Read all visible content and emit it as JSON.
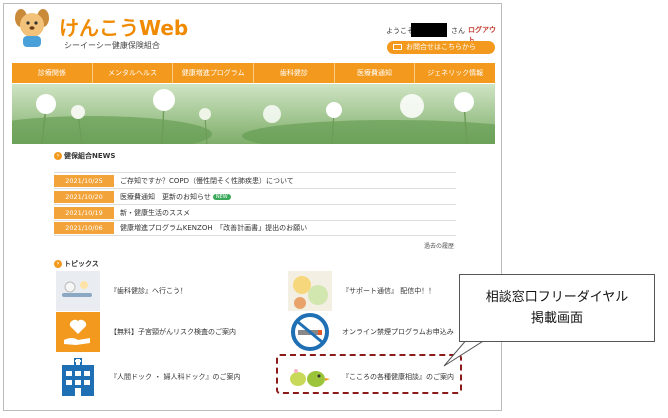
{
  "header": {
    "brand": "けんこうWeb",
    "sub_brand": "シーイーシー健康保険組合",
    "welcome": "ようこそ",
    "honorific": "さん",
    "logout": "ログアウト",
    "inquiry": "お問合せはこちらから"
  },
  "nav": [
    "診療関係",
    "メンタルヘルス",
    "健康増進プログラム",
    "歯科健診",
    "医療費通知",
    "ジェネリック情報"
  ],
  "news": {
    "heading": "健保組合NEWS",
    "items": [
      {
        "date": "2021/10/25",
        "title": "ご存知ですか？COPD（慢性閉そく性肺疾患）について"
      },
      {
        "date": "2021/10/20",
        "title": "医療費通知　更新のお知らせ",
        "badge": "NEW"
      },
      {
        "date": "2021/10/19",
        "title": "新・健康生活のススメ"
      },
      {
        "date": "2021/10/06",
        "title": "健康増進プログラムKENZOH　「改善計画書」提出のお願い"
      }
    ],
    "past_link": "過去の履歴"
  },
  "topics": {
    "heading": "トピックス",
    "items": [
      {
        "label": "『歯科健診』へ行こう！",
        "icon": "dental-icon"
      },
      {
        "label": "『サポート通信』 配信中！！",
        "icon": "food-photo-icon"
      },
      {
        "label": "【無料】子宮頸がんリスク検査のご案内",
        "icon": "heart-hand-icon"
      },
      {
        "label": "オンライン禁煙プログラムお申込み",
        "icon": "no-smoking-icon"
      },
      {
        "label": "『人間ドック ・ 婦人科ドック』のご案内",
        "icon": "hospital-icon"
      },
      {
        "label": "『こころの各種健康相談』のご案内",
        "icon": "bird-icon"
      }
    ]
  },
  "callout": {
    "line1": "相談窓口フリーダイヤル",
    "line2": "掲載画面"
  },
  "colors": {
    "accent": "#f39a1e",
    "callout_border": "#8b1a1a"
  }
}
